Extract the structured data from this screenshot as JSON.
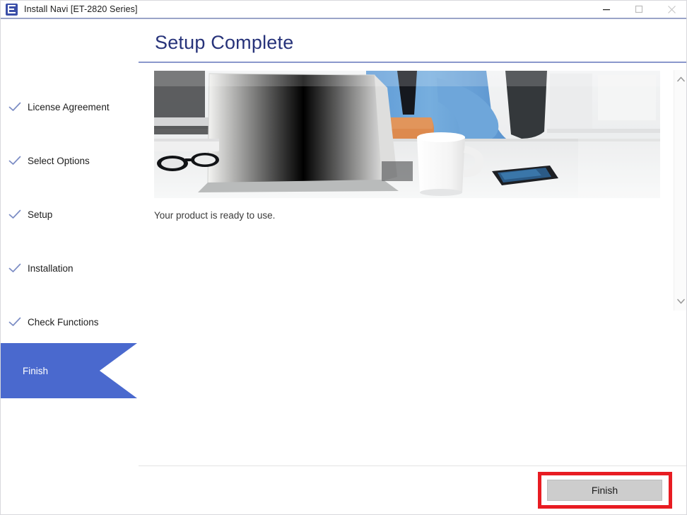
{
  "window": {
    "title": "Install Navi [ET-2820 Series]",
    "app_icon": "epson-e-icon",
    "controls": {
      "minimize": "minimize-icon",
      "maximize": "maximize-icon",
      "close": "close-icon"
    }
  },
  "page": {
    "heading": "Setup Complete",
    "message": "Your product is ready to use.",
    "hero_image_alt": "office-desk-with-laptop-photo"
  },
  "sidebar": {
    "items": [
      {
        "label": "License Agreement",
        "state": "completed",
        "icon": "check-icon"
      },
      {
        "label": "Select Options",
        "state": "completed",
        "icon": "check-icon"
      },
      {
        "label": "Setup",
        "state": "completed",
        "icon": "check-icon"
      },
      {
        "label": "Installation",
        "state": "completed",
        "icon": "check-icon"
      },
      {
        "label": "Check Functions",
        "state": "completed",
        "icon": "check-icon"
      }
    ],
    "current": {
      "label": "Finish",
      "state": "current"
    }
  },
  "scrollbar": {
    "up_arrow": "chevron-up-icon",
    "down_arrow": "chevron-down-icon"
  },
  "footer": {
    "finish_label": "Finish"
  },
  "colors": {
    "accent_blue": "#4a69ce",
    "heading_blue": "#27337a",
    "rule_blue": "#8a98cc",
    "check_blue": "#7b8cc4",
    "highlight_red": "#e81c22",
    "button_grey": "#cdcdcd",
    "title_icon_blue": "#3b4fa8"
  }
}
